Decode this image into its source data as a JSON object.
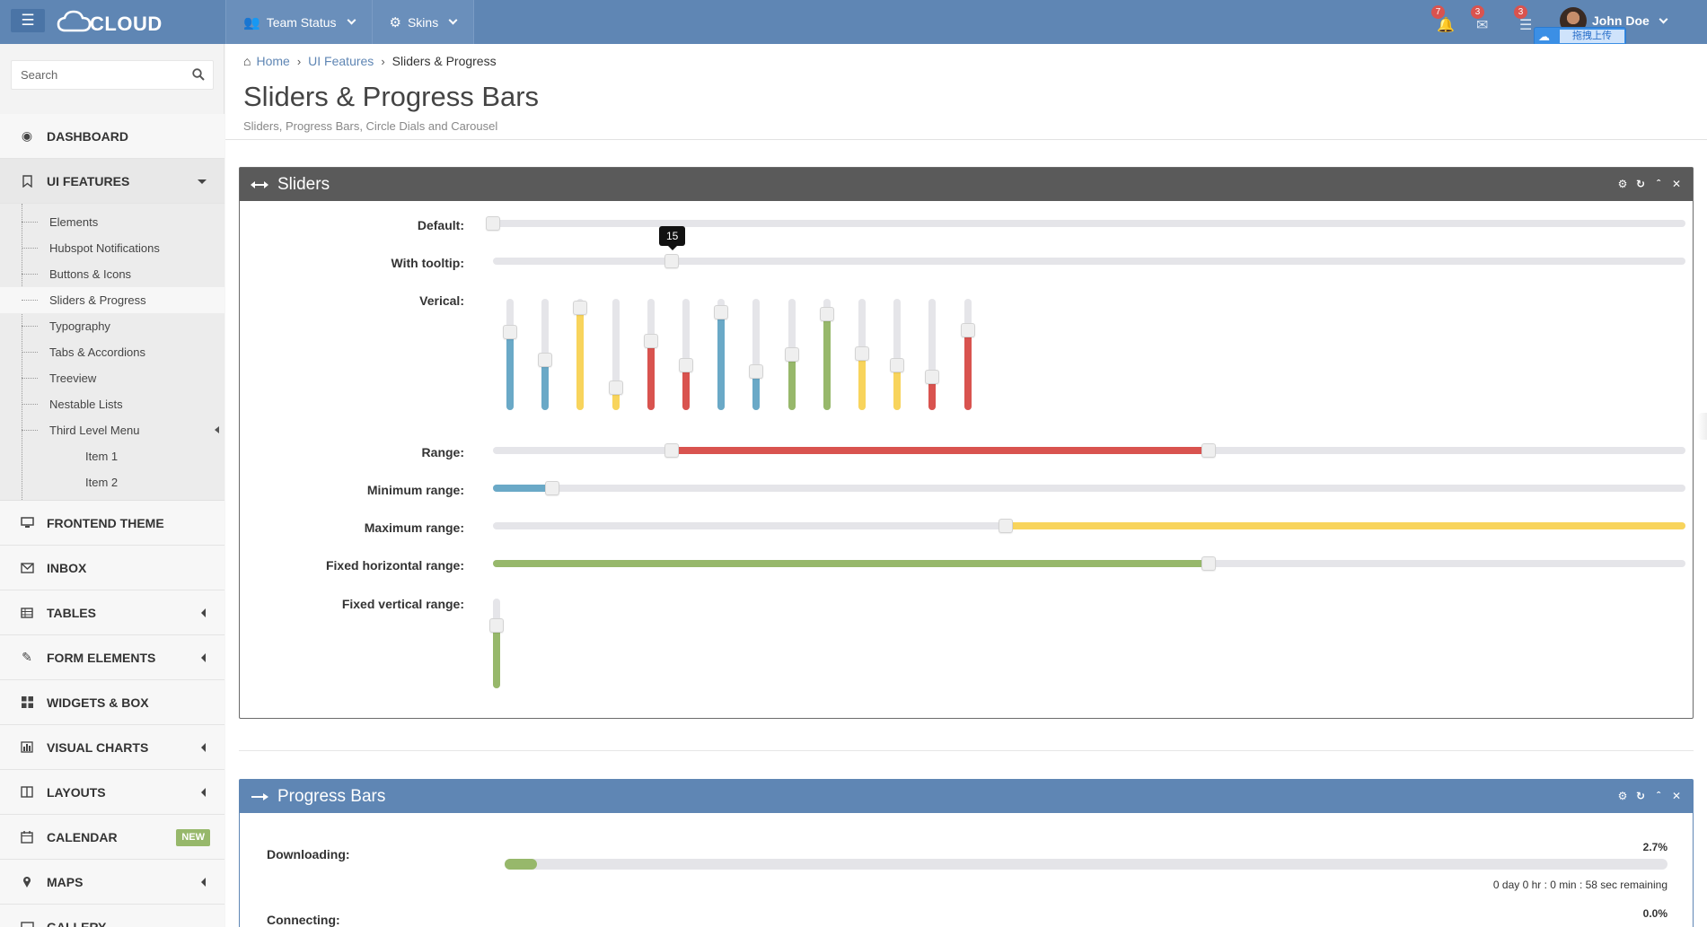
{
  "brand": {
    "name": "CLOUD"
  },
  "topnav": [
    {
      "label": "Team Status",
      "icon": "users-icon"
    },
    {
      "label": "Skins",
      "icon": "gear-icon"
    }
  ],
  "notifications": [
    {
      "icon": "bell-icon",
      "count": "7"
    },
    {
      "icon": "envelope-icon",
      "count": "3"
    },
    {
      "icon": "list-icon",
      "count": "3"
    }
  ],
  "user": {
    "name": "John Doe"
  },
  "upload": {
    "label": "拖拽上传"
  },
  "sidebar": {
    "search_placeholder": "Search",
    "items": [
      {
        "label": "DASHBOARD",
        "icon": "dashboard-icon"
      },
      {
        "label": "UI FEATURES",
        "icon": "bookmark-icon"
      },
      {
        "label": "FRONTEND THEME",
        "icon": "desktop-icon"
      },
      {
        "label": "INBOX",
        "icon": "envelope-icon"
      },
      {
        "label": "TABLES",
        "icon": "table-icon"
      },
      {
        "label": "FORM ELEMENTS",
        "icon": "edit-icon"
      },
      {
        "label": "WIDGETS & BOX",
        "icon": "grid-icon"
      },
      {
        "label": "VISUAL CHARTS",
        "icon": "bar-chart-icon"
      },
      {
        "label": "LAYOUTS",
        "icon": "columns-icon"
      },
      {
        "label": "CALENDAR",
        "icon": "calendar-icon",
        "badge": "NEW"
      },
      {
        "label": "MAPS",
        "icon": "map-marker-icon"
      },
      {
        "label": "GALLERY",
        "icon": "picture-icon"
      }
    ],
    "sub_items": [
      "Elements",
      "Hubspot Notifications",
      "Buttons & Icons",
      "Sliders & Progress",
      "Typography",
      "Tabs & Accordions",
      "Treeview",
      "Nestable Lists",
      "Third Level Menu"
    ],
    "third_level": [
      "Item 1",
      "Item 2"
    ]
  },
  "breadcrumb": [
    "Home",
    "UI Features",
    "Sliders & Progress"
  ],
  "page": {
    "title": "Sliders & Progress Bars",
    "subtitle": "Sliders, Progress Bars, Circle Dials and Carousel"
  },
  "sliders": {
    "title": "Sliders",
    "labels": {
      "default": "Default:",
      "tooltip": "With tooltip:",
      "vertical": "Verical:",
      "range": "Range:",
      "min_range": "Minimum range:",
      "max_range": "Maximum range:",
      "fixed_h": "Fixed horizontal range:",
      "fixed_v": "Fixed vertical range:"
    },
    "tooltip_value": "15",
    "default_value": 0,
    "tooltip_slider_value": 15,
    "range": [
      15,
      60
    ],
    "min_range": 5,
    "max_range": 43,
    "fixed_horizontal": 60,
    "fixed_vertical": 70,
    "vertical_values": [
      {
        "value": 70,
        "color": "#6aa9c7"
      },
      {
        "value": 45,
        "color": "#6aa9c7"
      },
      {
        "value": 92,
        "color": "#f8d45c"
      },
      {
        "value": 20,
        "color": "#f8d45c"
      },
      {
        "value": 62,
        "color": "#d9534f"
      },
      {
        "value": 40,
        "color": "#d9534f"
      },
      {
        "value": 88,
        "color": "#6aa9c7"
      },
      {
        "value": 35,
        "color": "#6aa9c7"
      },
      {
        "value": 50,
        "color": "#97b86b"
      },
      {
        "value": 86,
        "color": "#97b86b"
      },
      {
        "value": 51,
        "color": "#f8d45c"
      },
      {
        "value": 40,
        "color": "#f8d45c"
      },
      {
        "value": 30,
        "color": "#d9534f"
      },
      {
        "value": 72,
        "color": "#d9534f"
      }
    ],
    "colors": {
      "blue": "#6aa9c7",
      "red": "#d9534f",
      "yellow": "#f8d45c",
      "green": "#97b86b"
    }
  },
  "progress": {
    "title": "Progress Bars",
    "rows": [
      {
        "label": "Downloading:",
        "percent_text": "2.7%",
        "percent": 2.7,
        "remaining": "0 day 0 hr : 0 min : 58 sec remaining"
      },
      {
        "label": "Connecting:",
        "percent_text": "0.0%",
        "percent": 0
      }
    ]
  }
}
